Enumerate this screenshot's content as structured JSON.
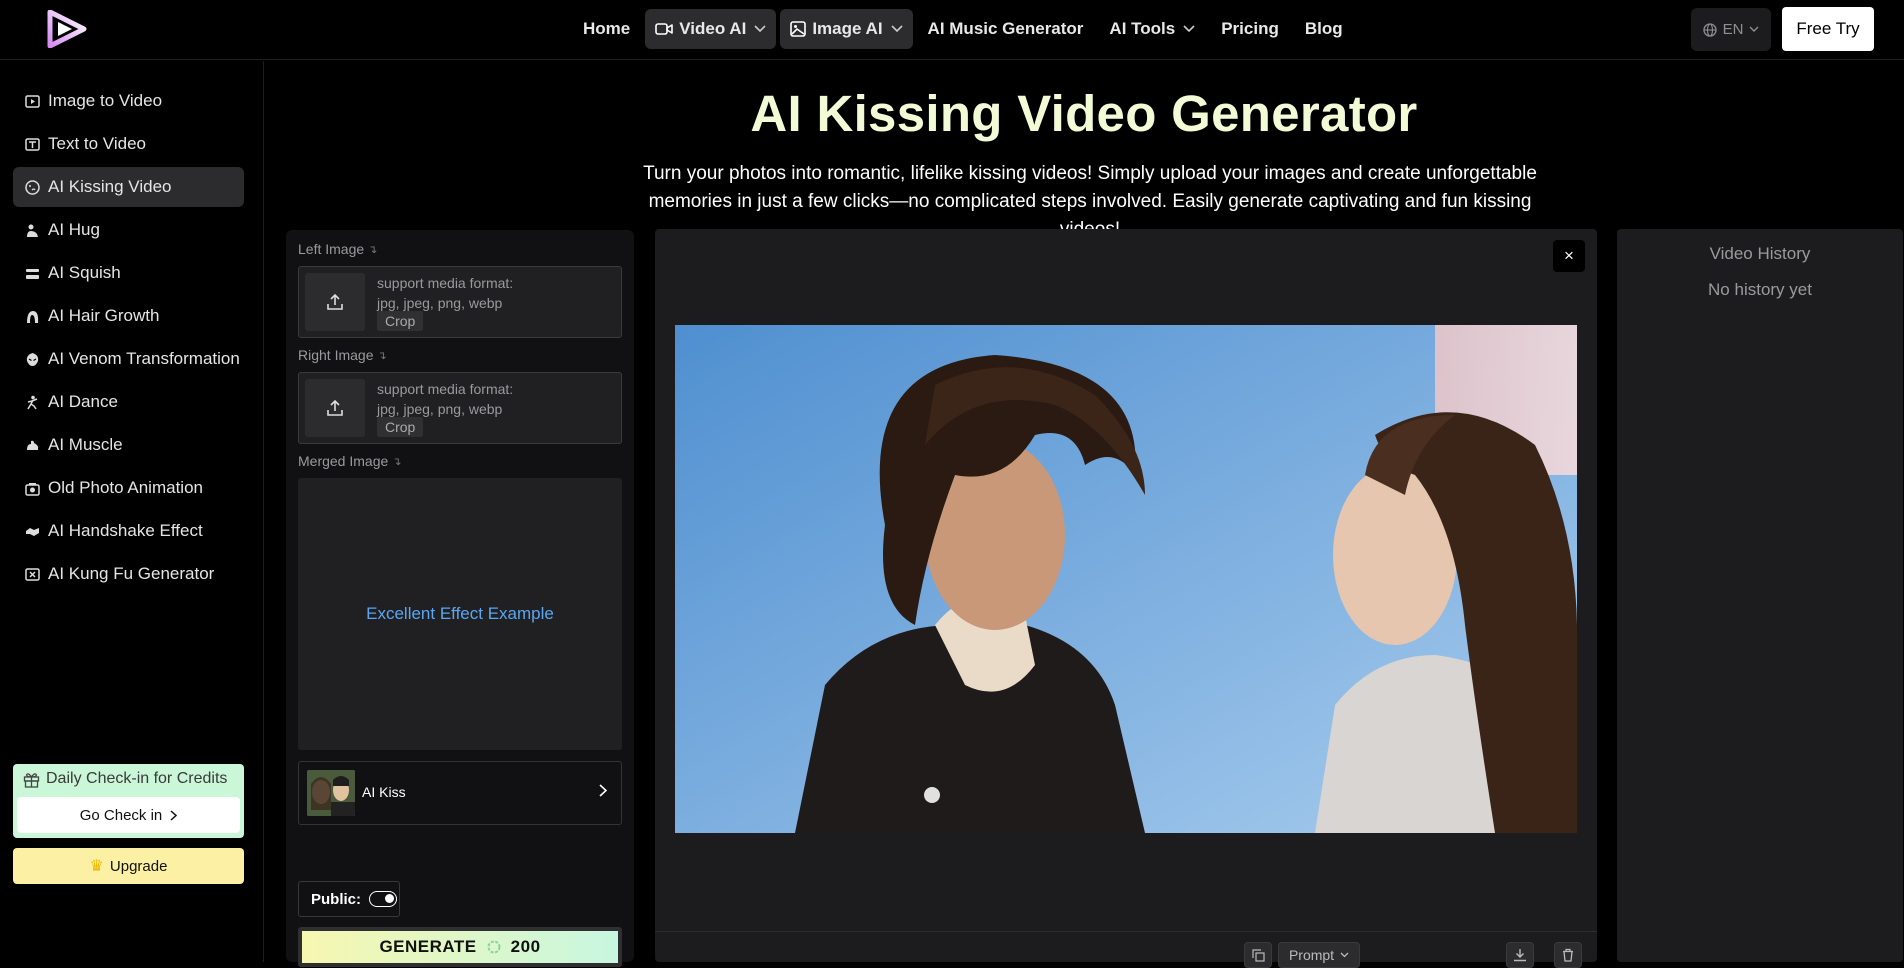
{
  "nav": {
    "items": [
      {
        "label": "Home",
        "icon": "",
        "dropdown": false,
        "highlighted": false
      },
      {
        "label": "Video AI",
        "icon": "video-camera-icon",
        "dropdown": true,
        "highlighted": true
      },
      {
        "label": "Image AI",
        "icon": "image-icon",
        "dropdown": true,
        "highlighted": true
      },
      {
        "label": "AI Music Generator",
        "icon": "",
        "dropdown": false,
        "highlighted": false
      },
      {
        "label": "AI Tools",
        "icon": "",
        "dropdown": true,
        "highlighted": false
      },
      {
        "label": "Pricing",
        "icon": "",
        "dropdown": false,
        "highlighted": false
      },
      {
        "label": "Blog",
        "icon": "",
        "dropdown": false,
        "highlighted": false
      }
    ],
    "language": "EN",
    "free_try": "Free Try"
  },
  "sidebar": {
    "items": [
      {
        "label": "Image to Video",
        "icon": "image-to-video-icon",
        "active": false
      },
      {
        "label": "Text to Video",
        "icon": "text-to-video-icon",
        "active": false
      },
      {
        "label": "AI Kissing Video",
        "icon": "kiss-icon",
        "active": true
      },
      {
        "label": "AI Hug",
        "icon": "hug-icon",
        "active": false
      },
      {
        "label": "AI Squish",
        "icon": "squish-icon",
        "active": false
      },
      {
        "label": "AI Hair Growth",
        "icon": "hair-icon",
        "active": false
      },
      {
        "label": "AI Venom Transformation",
        "icon": "venom-icon",
        "active": false
      },
      {
        "label": "AI Dance",
        "icon": "dance-icon",
        "active": false
      },
      {
        "label": "AI Muscle",
        "icon": "muscle-icon",
        "active": false
      },
      {
        "label": "Old Photo Animation",
        "icon": "old-photo-icon",
        "active": false
      },
      {
        "label": "AI Handshake Effect",
        "icon": "handshake-icon",
        "active": false
      },
      {
        "label": "AI Kung Fu Generator",
        "icon": "kung-fu-icon",
        "active": false
      }
    ],
    "checkin": {
      "title": "Daily Check-in for Credits",
      "button": "Go Check in"
    },
    "upgrade": "Upgrade"
  },
  "hero": {
    "title": "AI Kissing Video Generator",
    "description": "Turn your photos into romantic, lifelike kissing videos! Simply upload your images and create unforgettable memories in just a few clicks—no complicated steps involved. Easily generate captivating and fun kissing videos!"
  },
  "form": {
    "left_image": {
      "label": "Left Image",
      "format_line1": "support media format:",
      "format_line2": "jpg, jpeg, png, webp",
      "crop": "Crop"
    },
    "right_image": {
      "label": "Right Image",
      "format_line1": "support media format:",
      "format_line2": "jpg, jpeg, png, webp",
      "crop": "Crop"
    },
    "merged_image": {
      "label": "Merged Image",
      "example_link": "Excellent Effect Example"
    },
    "template": {
      "label": "AI Kiss"
    },
    "public_label": "Public:",
    "generate": {
      "label": "GENERATE",
      "credits": "200"
    }
  },
  "preview": {
    "close": "×",
    "prompt_button": "Prompt"
  },
  "history": {
    "title": "Video History",
    "empty": "No history yet"
  },
  "colors": {
    "accent_title": "#f3fbd6",
    "link": "#5aa6f2",
    "checkin_bg": "#c9f7d8",
    "upgrade_bg": "#fbf0a3"
  }
}
